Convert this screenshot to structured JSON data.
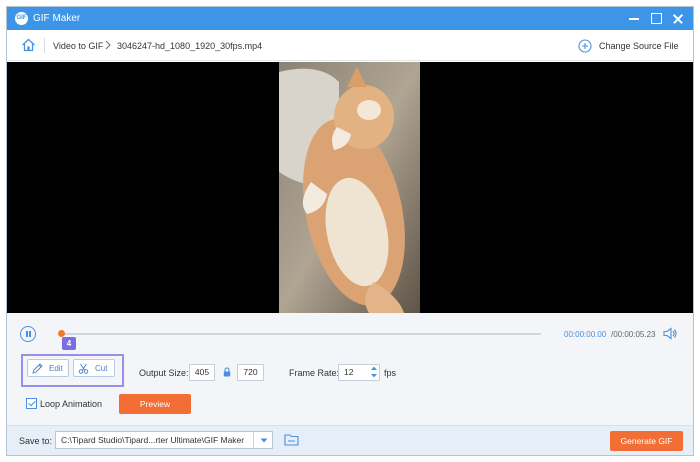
{
  "window": {
    "title": "GIF Maker",
    "app_icon_text": "GIF"
  },
  "nav": {
    "breadcrumb_root": "Video to GIF",
    "breadcrumb_file": "3046247-hd_1080_1920_30fps.mp4",
    "change_source_label": "Change Source File"
  },
  "player": {
    "current_time": "00:00:00.00",
    "total_time": "/00:00:05.23",
    "progress_fraction": 0.0
  },
  "annotation": {
    "step_number": "4",
    "highlight_color": "#9a8fe8"
  },
  "tools": {
    "edit_label": "Edit",
    "cut_label": "Cut"
  },
  "settings": {
    "output_size_label": "Output Size:",
    "width": "405",
    "height": "720",
    "frame_rate_label": "Frame Rate:",
    "frame_rate": "12",
    "fps_label": "fps",
    "loop_label": "Loop Animation",
    "loop_checked": true,
    "preview_label": "Preview"
  },
  "footer": {
    "save_to_label": "Save to:",
    "path": "C:\\Tipard Studio\\Tipard...rter Ultimate\\GIF Maker",
    "generate_label": "Generate GIF"
  },
  "colors": {
    "titlebar": "#3d95e8",
    "accent": "#4a90e2",
    "orange": "#f26e35",
    "badge": "#7a6fe0"
  },
  "icons": [
    "home-icon",
    "chevron-right-icon",
    "plus-circle-icon",
    "pause-icon",
    "volume-icon",
    "edit-icon",
    "scissors-icon",
    "lock-icon",
    "folder-icon",
    "chevron-down-icon"
  ]
}
